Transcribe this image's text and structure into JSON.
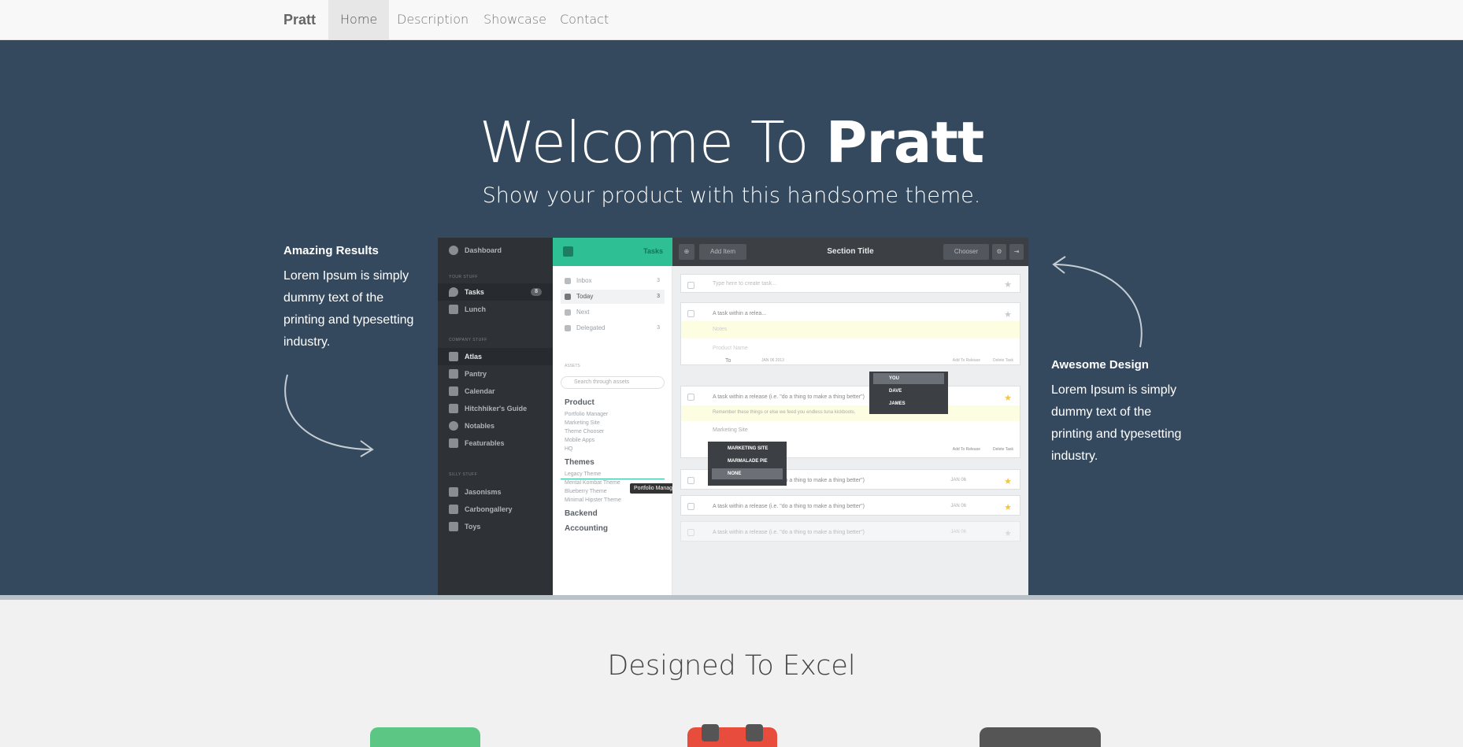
{
  "nav": {
    "brand": "Pratt",
    "items": [
      {
        "label": "Home",
        "active": true
      },
      {
        "label": "Description",
        "active": false
      },
      {
        "label": "Showcase",
        "active": false
      },
      {
        "label": "Contact",
        "active": false
      }
    ]
  },
  "hero": {
    "title_light": "Welcome To ",
    "title_bold": "Pratt",
    "subtitle": "Show your product with this handsome theme.",
    "left": {
      "heading": "Amazing Results",
      "text": "Lorem Ipsum is simply dummy text of the printing and typesetting industry."
    },
    "right": {
      "heading": "Awesome Design",
      "text": "Lorem Ipsum is simply dummy text of the printing and typesetting industry."
    },
    "colors": {
      "background": "#34495e",
      "accent": "#2fbf95"
    }
  },
  "app": {
    "sidebar": {
      "dashboard": "Dashboard",
      "sections": [
        "YOUR STUFF",
        "COMPANY STUFF",
        "SILLY STUFF"
      ],
      "your_stuff": [
        {
          "label": "Tasks",
          "badge": "8"
        },
        {
          "label": "Lunch"
        }
      ],
      "company_stuff": [
        "Atlas",
        "Pantry",
        "Calendar",
        "Hitchhiker's Guide",
        "Notables",
        "Featurables"
      ],
      "silly_stuff": [
        "Jasonisms",
        "Carbongallery",
        "Toys"
      ]
    },
    "middle": {
      "header": "Tasks",
      "filters": [
        {
          "label": "Inbox",
          "count": "3"
        },
        {
          "label": "Today",
          "count": "3"
        },
        {
          "label": "Next",
          "count": ""
        },
        {
          "label": "Delegated",
          "count": "3"
        }
      ],
      "assets_label": "ASSETS",
      "search_placeholder": "Search through assets",
      "product": {
        "title": "Product",
        "items": [
          "Portfolio Manager",
          "Marketing Site",
          "Theme Chooser",
          "Mobile Apps",
          "HQ"
        ]
      },
      "themes": {
        "title": "Themes",
        "items": [
          "Legacy Theme",
          "Mental Kombat Theme",
          "Blueberry Theme",
          "Minimal Hipster Theme"
        ]
      },
      "backend": "Backend",
      "accounting": "Accounting",
      "tooltip": "Portfolio Manager"
    },
    "main": {
      "title": "Section Title",
      "add_item": "Add Item",
      "chooser": "Chooser",
      "new_task_placeholder": "Type here to create task...",
      "task1": {
        "title": "A task within a relea...",
        "notes": "Notes",
        "product": "Product Name",
        "to": "To",
        "date": "JAN 06 2013",
        "add_release": "Add To Release",
        "delete": "Delete Task"
      },
      "task2": {
        "title": "A task within a release (i.e. \"do a thing to make a thing better\")",
        "note": "Remember these things or else we feed you endless tuna kickboots.",
        "field": "Marketing Site",
        "add_release": "Add To Release",
        "delete": "Delete Task"
      },
      "assignee_menu": [
        "YOU",
        "DAVE",
        "JAMES"
      ],
      "project_menu": [
        "MARKETING SITE",
        "MARMALADE PIE",
        "NONE"
      ],
      "tasks": [
        {
          "title": "A task within a release (i.e. \"do a thing to make a thing better\")",
          "date": "JAN 06"
        },
        {
          "title": "A task within a release (i.e. \"do a thing to make a thing better\")",
          "date": "JAN 06"
        },
        {
          "title": "A task within a release (i.e. \"do a thing to make a thing better\")",
          "date": "JAN 06"
        }
      ]
    }
  },
  "features": {
    "title": "Designed To Excel"
  }
}
